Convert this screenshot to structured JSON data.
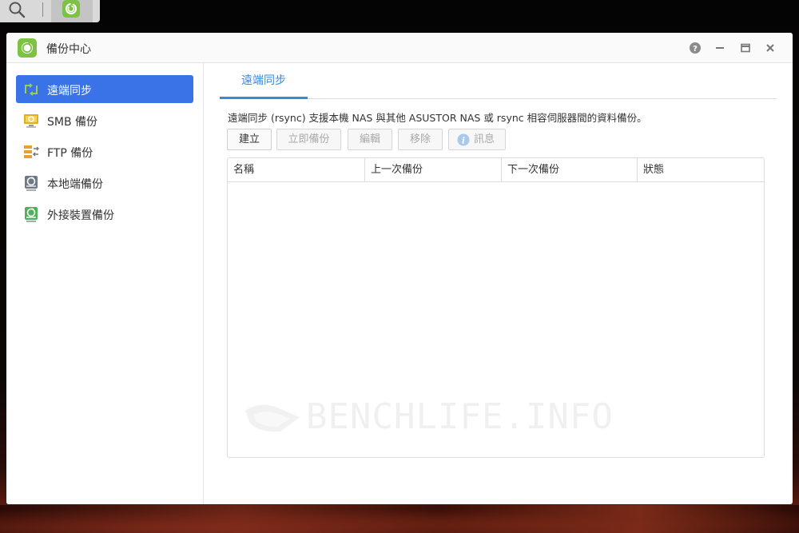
{
  "window": {
    "title": "備份中心"
  },
  "sidebar": {
    "items": [
      {
        "label": "遠端同步",
        "icon": "sync-folder-icon",
        "active": true
      },
      {
        "label": "SMB 備份",
        "icon": "smb-backup-icon",
        "active": false
      },
      {
        "label": "FTP 備份",
        "icon": "ftp-backup-icon",
        "active": false
      },
      {
        "label": "本地端備份",
        "icon": "local-backup-icon",
        "active": false
      },
      {
        "label": "外接裝置備份",
        "icon": "external-device-icon",
        "active": false
      }
    ]
  },
  "main": {
    "tabs": [
      {
        "label": "遠端同步"
      }
    ],
    "description": "遠端同步 (rsync) 支援本機 NAS 與其他 ASUSTOR NAS 或 rsync 相容伺服器間的資料備份。",
    "toolbar": {
      "create_label": "建立",
      "backup_now_label": "立即備份",
      "edit_label": "編輯",
      "remove_label": "移除",
      "info_label": "訊息"
    },
    "table": {
      "columns": [
        "名稱",
        "上一次備份",
        "下一次備份",
        "狀態"
      ],
      "rows": []
    }
  },
  "watermark": {
    "text": "BENCHLIFE.INFO"
  },
  "colors": {
    "accent": "#3a73e8",
    "tab_active": "#3a88d8",
    "app_green": "#7dc242"
  }
}
